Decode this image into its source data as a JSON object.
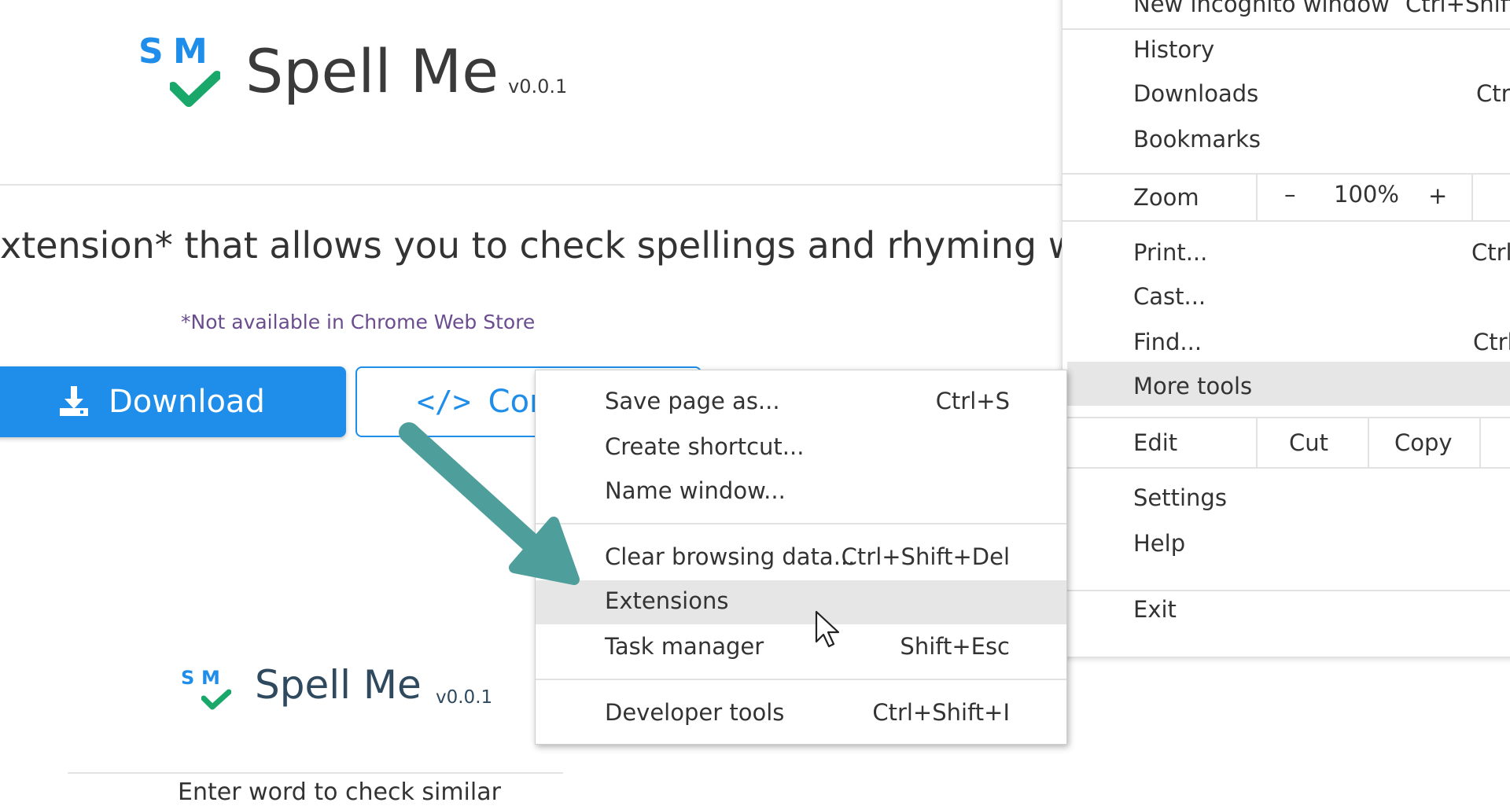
{
  "header": {
    "logo_letters": {
      "s": "S",
      "m": "M"
    },
    "title": "Spell Me",
    "version": "v0.0.1"
  },
  "intro": {
    "tagline": "xtension* that allows you to check spellings and rhyming words a",
    "notice": "*Not available in Chrome Web Store"
  },
  "buttons": {
    "download_label": "Download",
    "contribute_icon": "</>",
    "contribute_label": "Con"
  },
  "popup": {
    "logo_letters": {
      "s": "S",
      "m": "M"
    },
    "title": "Spell Me",
    "version": "v0.0.1",
    "input_label": "Enter word to check similar"
  },
  "chrome_menu": {
    "top_item": {
      "label": "New incognito window",
      "shortcut": "Ctrl+Shift+"
    },
    "group1": [
      {
        "label": "History",
        "shortcut": ""
      },
      {
        "label": "Downloads",
        "shortcut": "Ctrl"
      },
      {
        "label": "Bookmarks",
        "shortcut": ""
      }
    ],
    "zoom": {
      "label": "Zoom",
      "minus": "–",
      "value": "100%",
      "plus": "+"
    },
    "group2": [
      {
        "label": "Print...",
        "shortcut": "Ctrl"
      },
      {
        "label": "Cast...",
        "shortcut": ""
      },
      {
        "label": "Find...",
        "shortcut": "Ctrl"
      },
      {
        "label": "More tools",
        "shortcut": ""
      }
    ],
    "edit": {
      "label": "Edit",
      "cut": "Cut",
      "copy": "Copy"
    },
    "group3": [
      {
        "label": "Settings"
      },
      {
        "label": "Help"
      }
    ],
    "exit": "Exit"
  },
  "more_tools_menu": {
    "group1": [
      {
        "label": "Save page as...",
        "shortcut": "Ctrl+S"
      },
      {
        "label": "Create shortcut...",
        "shortcut": ""
      },
      {
        "label": "Name window...",
        "shortcut": ""
      }
    ],
    "group2": [
      {
        "label": "Clear browsing data...",
        "shortcut": "Ctrl+Shift+Del"
      },
      {
        "label": "Extensions",
        "shortcut": ""
      },
      {
        "label": "Task manager",
        "shortcut": "Shift+Esc"
      }
    ],
    "group3": [
      {
        "label": "Developer tools",
        "shortcut": "Ctrl+Shift+I"
      }
    ],
    "highlighted_item": "Extensions"
  },
  "colors": {
    "brand_blue": "#1f8eea",
    "check_green": "#1aa86a",
    "arrow_teal": "#4e9e9c",
    "notice_purple": "#6b4c8f",
    "menu_highlight": "#e6e6e6"
  },
  "icons": {
    "download": "download-icon",
    "code": "code-icon",
    "checkmark": "checkmark-icon",
    "pointer": "mouse-pointer-icon",
    "annotation": "arrow-annotation"
  }
}
